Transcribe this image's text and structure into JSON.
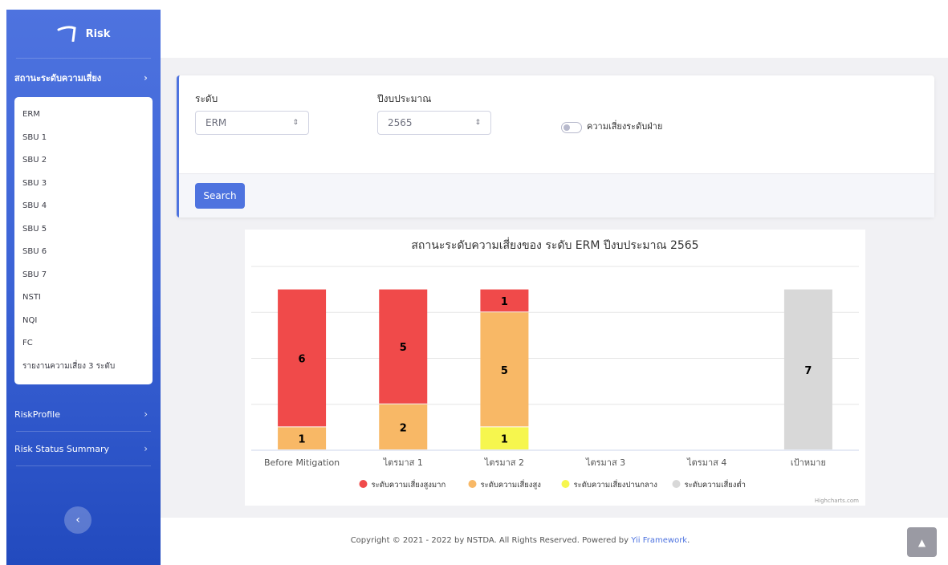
{
  "brand": {
    "name": "Risk",
    "icon": "logo-icon"
  },
  "sidebar": {
    "sections": [
      {
        "label": "สถานะระดับความเสี่ยง",
        "expanded": true,
        "icon": "chevron-right-icon"
      },
      {
        "label": "RiskProfile",
        "expanded": false,
        "icon": "chevron-right-icon"
      },
      {
        "label": "Risk Status Summary",
        "expanded": false,
        "icon": "chevron-right-icon"
      }
    ],
    "submenu": [
      "ERM",
      "SBU 1",
      "SBU 2",
      "SBU 3",
      "SBU 4",
      "SBU 5",
      "SBU 6",
      "SBU 7",
      "NSTI",
      "NQI",
      "FC",
      "รายงานความเสี่ยง 3 ระดับ"
    ],
    "collapse_icon": "chevron-left-icon"
  },
  "filter": {
    "level_label": "ระดับ",
    "level_value": "ERM",
    "year_label": "ปีงบประมาณ",
    "year_value": "2565",
    "toggle_label": "ความเสี่ยงระดับฝ่าย",
    "toggle_on": false,
    "search_label": "Search"
  },
  "chart_data": {
    "type": "bar",
    "stacked": true,
    "title": "สถานะระดับความเสี่ยงของ ระดับ ERM ปีงบประมาณ 2565",
    "categories": [
      "Before Mitigation",
      "ไตรมาส 1",
      "ไตรมาส 2",
      "ไตรมาส 3",
      "ไตรมาส 4",
      "เป้าหมาย"
    ],
    "series": [
      {
        "name": "ระดับความเสี่ยงสูงมาก",
        "color": "#f04a4a",
        "values": [
          6,
          5,
          1,
          0,
          0,
          0
        ]
      },
      {
        "name": "ระดับความเสี่ยงสูง",
        "color": "#f8b866",
        "values": [
          1,
          2,
          5,
          0,
          0,
          0
        ]
      },
      {
        "name": "ระดับความเสี่ยงปานกลาง",
        "color": "#f6f64e",
        "values": [
          0,
          0,
          1,
          0,
          0,
          0
        ]
      },
      {
        "name": "ระดับความเสี่ยงต่ำ",
        "color": "#d8d8d8",
        "values": [
          0,
          0,
          0,
          0,
          0,
          7
        ]
      }
    ],
    "ylim": [
      0,
      8
    ],
    "grid": true,
    "legend": "bottom-center",
    "credits": "Highcharts.com"
  },
  "footer": {
    "copyright": "Copyright © 2021 - 2022 by NSTDA. All Rights Reserved. Powered by",
    "link": "Yii Framework",
    "suffix": ".",
    "scroll_top_icon": "chevron-up-icon"
  }
}
